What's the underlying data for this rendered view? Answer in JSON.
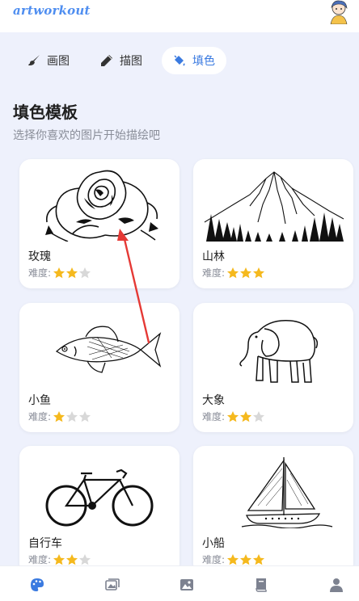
{
  "app": {
    "logo_text": "artworkout"
  },
  "tabs": [
    {
      "label": "画图",
      "icon": "paintbrush-icon"
    },
    {
      "label": "描图",
      "icon": "pencil-icon"
    },
    {
      "label": "填色",
      "icon": "paint-bucket-icon",
      "active": true
    }
  ],
  "section": {
    "title": "填色模板",
    "subtitle": "选择你喜欢的图片开始描绘吧"
  },
  "rating_label": "难度:",
  "templates": [
    {
      "name": "玫瑰",
      "difficulty": 2,
      "max": 3,
      "image": "rose-drawing"
    },
    {
      "name": "山林",
      "difficulty": 3,
      "max": 3,
      "image": "mountain-forest-drawing"
    },
    {
      "name": "小鱼",
      "difficulty": 1,
      "max": 3,
      "image": "fish-drawing"
    },
    {
      "name": "大象",
      "difficulty": 2,
      "max": 3,
      "image": "elephant-drawing"
    },
    {
      "name": "自行车",
      "difficulty": 2,
      "max": 3,
      "image": "bicycle-drawing"
    },
    {
      "name": "小船",
      "difficulty": 3,
      "max": 3,
      "image": "sailboat-drawing"
    }
  ],
  "bottom_nav": [
    {
      "icon": "palette-icon",
      "active": true
    },
    {
      "icon": "images-icon"
    },
    {
      "icon": "image-icon"
    },
    {
      "icon": "book-icon"
    },
    {
      "icon": "user-icon"
    }
  ],
  "colors": {
    "accent": "#3a7ae0",
    "star_on": "#f5b91e",
    "star_off": "#d8d8d8",
    "annotation": "#e53935"
  }
}
